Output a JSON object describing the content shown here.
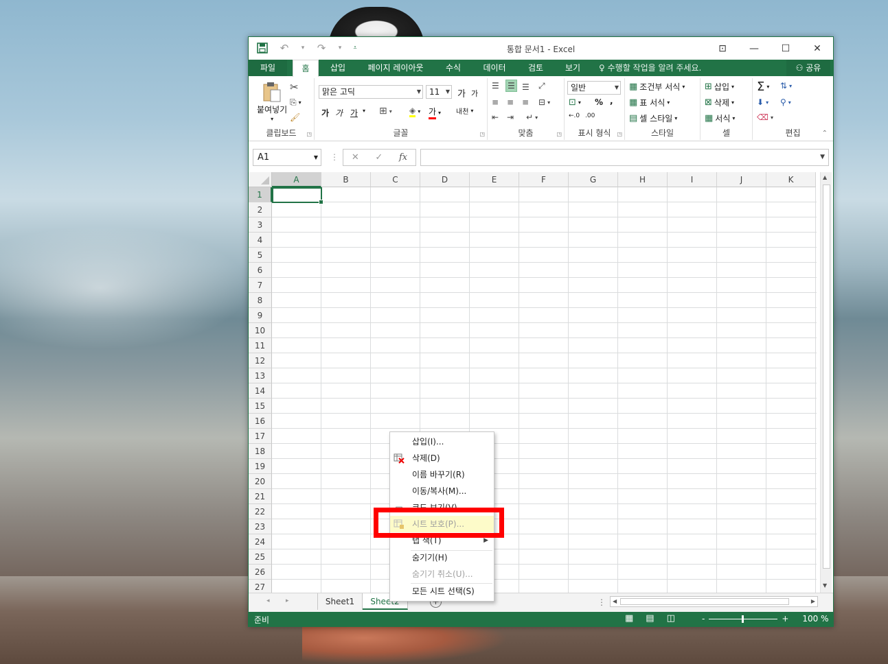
{
  "window": {
    "title": "통합 문서1 - Excel"
  },
  "tabs": {
    "file": "파일",
    "home": "홈",
    "insert": "삽입",
    "page_layout": "페이지 레이아웃",
    "formulas": "수식",
    "data": "데이터",
    "review": "검토",
    "view": "보기",
    "tell_me": "수행할 작업을 알려 주세요.",
    "share": "공유"
  },
  "ribbon": {
    "clipboard": {
      "label": "클립보드",
      "paste": "붙여넣기"
    },
    "font": {
      "label": "글꼴",
      "font_name": "맑은 고딕",
      "font_size": "11",
      "grow": "가",
      "shrink": "가",
      "bold": "가",
      "italic": "가",
      "underline": "가",
      "font_color": "가",
      "phonetic": "내천"
    },
    "alignment": {
      "label": "맞춤"
    },
    "number": {
      "label": "표시 형식",
      "format": "일반",
      "percent": "%",
      "comma": ",",
      "inc_dec": "←.0",
      "dec_dec": ".00"
    },
    "styles": {
      "label": "스타일",
      "conditional": "조건부 서식",
      "table": "표 서식",
      "cell": "셀 스타일"
    },
    "cells": {
      "label": "셀",
      "insert": "삽입",
      "delete": "삭제",
      "format": "서식"
    },
    "editing": {
      "label": "편집"
    }
  },
  "formula_bar": {
    "name_box": "A1",
    "fx": "fx",
    "value": ""
  },
  "grid": {
    "columns": [
      "A",
      "B",
      "C",
      "D",
      "E",
      "F",
      "G",
      "H",
      "I",
      "J",
      "K"
    ],
    "rows": [
      "1",
      "2",
      "3",
      "4",
      "5",
      "6",
      "7",
      "8",
      "9",
      "10",
      "11",
      "12",
      "13",
      "14",
      "15",
      "16",
      "17",
      "18",
      "19",
      "20",
      "21",
      "22",
      "23",
      "24",
      "25",
      "26",
      "27"
    ],
    "active_cell": "A1"
  },
  "sheets": {
    "tabs": [
      "Sheet1",
      "Sheet2"
    ],
    "active": "Sheet2"
  },
  "status": {
    "ready": "준비",
    "zoom": "100 %",
    "minus": "-",
    "plus": "+"
  },
  "context_menu": {
    "items": [
      {
        "label": "삽입(I)...",
        "enabled": true
      },
      {
        "label": "삭제(D)",
        "enabled": true
      },
      {
        "label": "이름 바꾸기(R)",
        "enabled": true
      },
      {
        "label": "이동/복사(M)...",
        "enabled": true
      },
      {
        "label": "코드 보기(V)",
        "enabled": true
      },
      {
        "label": "시트 보호(P)...",
        "enabled": false
      },
      {
        "label": "탭 색(T)",
        "enabled": true
      },
      {
        "label": "숨기기(H)",
        "enabled": true
      },
      {
        "label": "숨기기 취소(U)...",
        "enabled": false
      },
      {
        "label": "모든 시트 선택(S)",
        "enabled": true
      }
    ]
  },
  "colors": {
    "excel_green": "#217346",
    "highlight_red": "#ff0000"
  }
}
